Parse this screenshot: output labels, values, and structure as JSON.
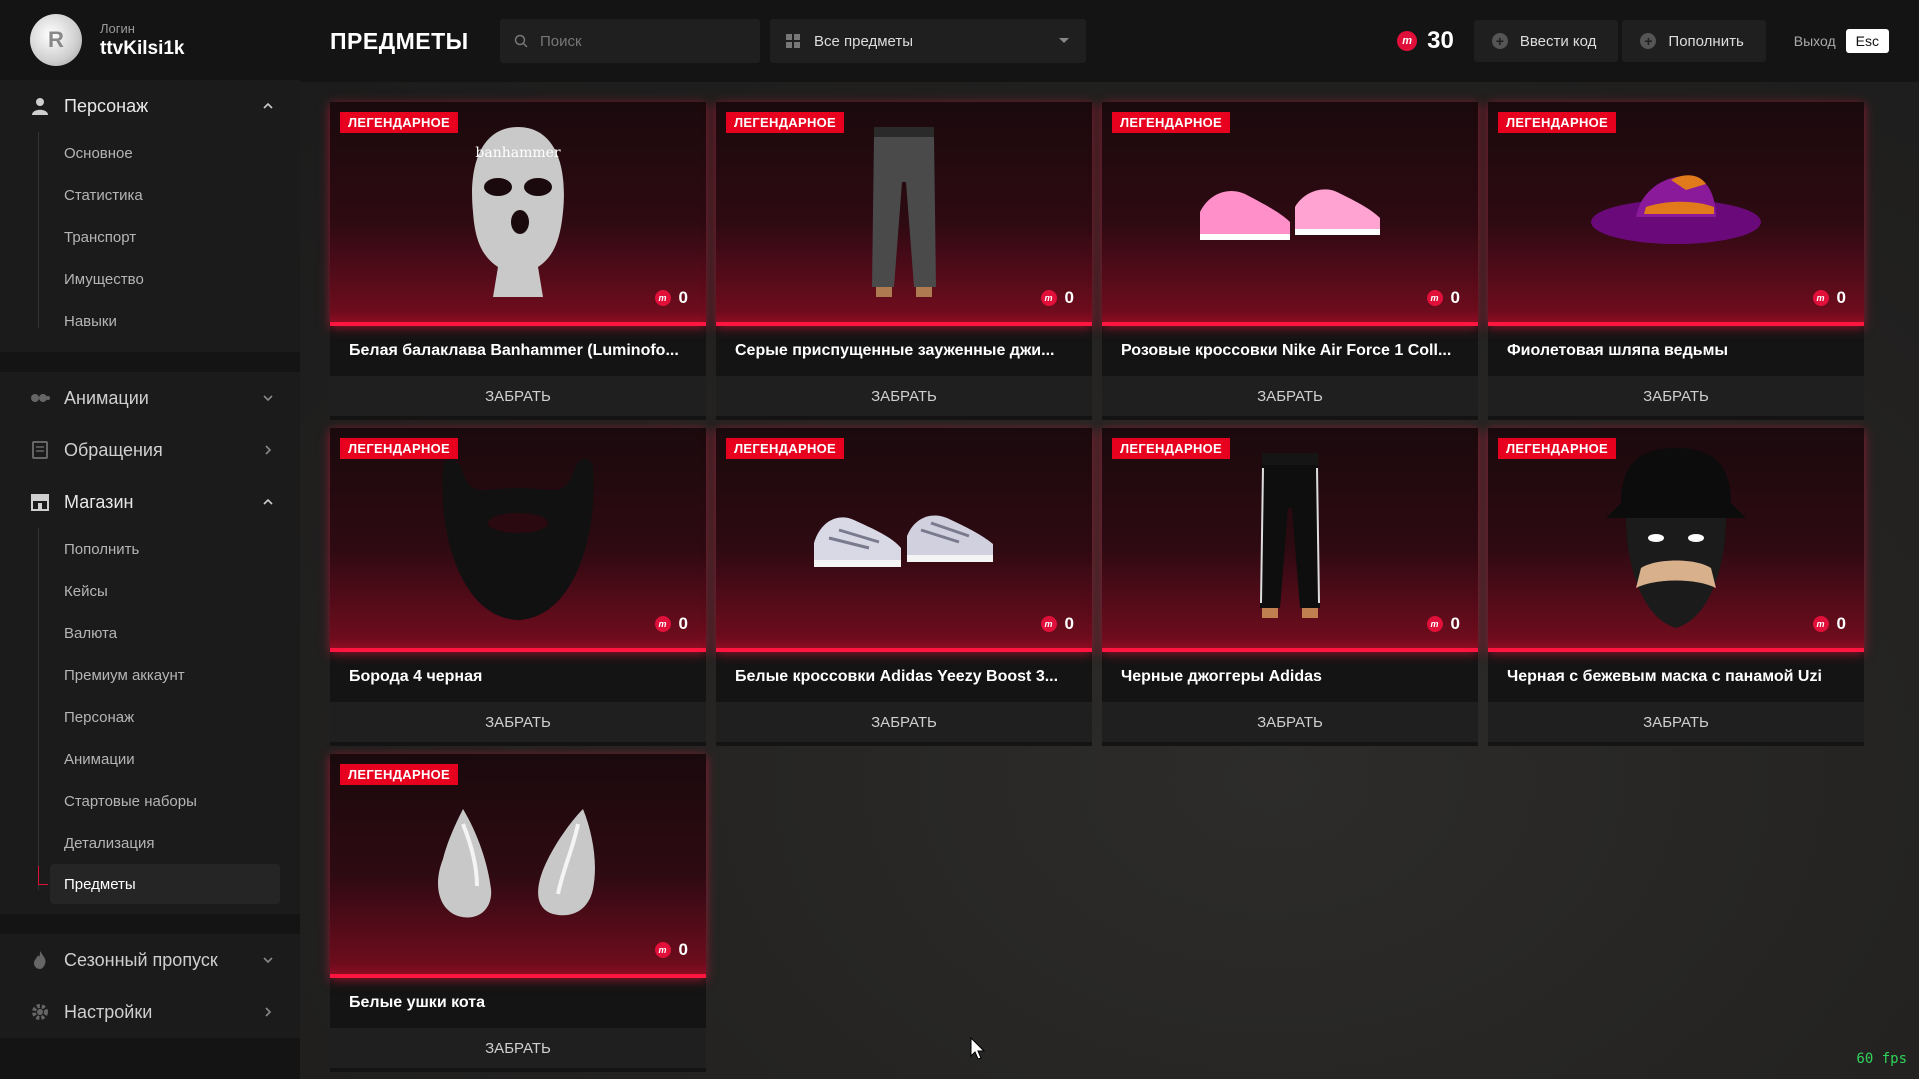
{
  "profile": {
    "login_label": "Логин",
    "username": "ttvKilsi1k"
  },
  "sidebar": {
    "character": {
      "label": "Персонаж",
      "items": [
        "Основное",
        "Статистика",
        "Транспорт",
        "Имущество",
        "Навыки"
      ]
    },
    "animations": {
      "label": "Анимации"
    },
    "appeals": {
      "label": "Обращения"
    },
    "shop": {
      "label": "Магазин",
      "items": [
        "Пополнить",
        "Кейсы",
        "Валюта",
        "Премиум аккаунт",
        "Персонаж",
        "Анимации",
        "Стартовые наборы",
        "Детализация",
        "Предметы"
      ],
      "active": "Предметы"
    },
    "season_pass": {
      "label": "Сезонный пропуск"
    },
    "settings": {
      "label": "Настройки"
    }
  },
  "header": {
    "title": "ПРЕДМЕТЫ",
    "search_placeholder": "Поиск",
    "filter_value": "Все предметы",
    "balance": "30",
    "enter_code": "Ввести код",
    "top_up": "Пополнить",
    "exit_label": "Выход",
    "exit_key": "Esc"
  },
  "items": [
    {
      "rarity": "ЛЕГЕНДАРНОЕ",
      "price": "0",
      "name": "Белая балаклава Banhammer (Luminofo...",
      "action": "ЗАБРАТЬ",
      "icon": "balaclava-icon"
    },
    {
      "rarity": "ЛЕГЕНДАРНОЕ",
      "price": "0",
      "name": "Серые приспущенные зауженные джи...",
      "action": "ЗАБРАТЬ",
      "icon": "jeans-icon"
    },
    {
      "rarity": "ЛЕГЕНДАРНОЕ",
      "price": "0",
      "name": "Розовые кроссовки Nike Air Force 1 Coll...",
      "action": "ЗАБРАТЬ",
      "icon": "sneakers-icon"
    },
    {
      "rarity": "ЛЕГЕНДАРНОЕ",
      "price": "0",
      "name": "Фиолетовая шляпа ведьмы",
      "action": "ЗАБРАТЬ",
      "icon": "witch-hat-icon"
    },
    {
      "rarity": "ЛЕГЕНДАРНОЕ",
      "price": "0",
      "name": "Борода 4 черная",
      "action": "ЗАБРАТЬ",
      "icon": "beard-icon"
    },
    {
      "rarity": "ЛЕГЕНДАРНОЕ",
      "price": "0",
      "name": "Белые кроссовки Adidas Yeezy Boost 3...",
      "action": "ЗАБРАТЬ",
      "icon": "sneakers-icon"
    },
    {
      "rarity": "ЛЕГЕНДАРНОЕ",
      "price": "0",
      "name": "Черные джоггеры Adidas",
      "action": "ЗАБРАТЬ",
      "icon": "joggers-icon"
    },
    {
      "rarity": "ЛЕГЕНДАРНОЕ",
      "price": "0",
      "name": "Черная с бежевым маска с панамой Uzi",
      "action": "ЗАБРАТЬ",
      "icon": "mask-hat-icon"
    },
    {
      "rarity": "ЛЕГЕНДАРНОЕ",
      "price": "0",
      "name": "Белые ушки кота",
      "action": "ЗАБРАТЬ",
      "icon": "cat-ears-icon"
    }
  ],
  "fps": "60 fps",
  "colors": {
    "accent": "#e8001f",
    "background": "#1a1a1a",
    "sidebar": "#141414"
  }
}
